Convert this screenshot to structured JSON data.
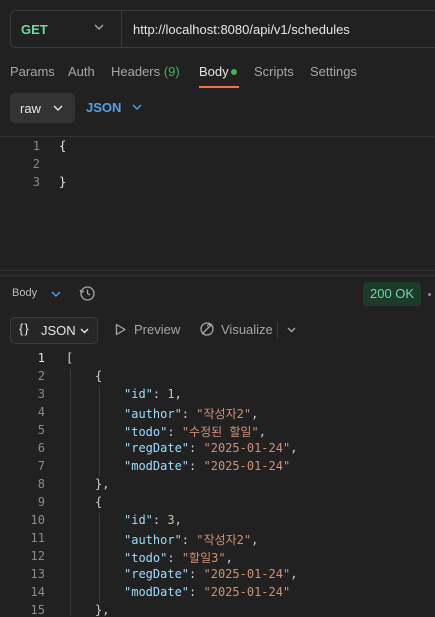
{
  "request": {
    "method": "GET",
    "url": "http://localhost:8080/api/v1/schedules"
  },
  "request_tabs": {
    "params": "Params",
    "auth": "Auth",
    "headers": "Headers",
    "headers_count": "(9)",
    "body": "Body",
    "scripts": "Scripts",
    "settings": "Settings"
  },
  "body_mode": {
    "mode": "raw",
    "language": "JSON"
  },
  "request_body": {
    "line_numbers": [
      "1",
      "2",
      "3"
    ],
    "lines": [
      "{",
      "",
      "}"
    ]
  },
  "response": {
    "section_label": "Body",
    "status": "200 OK",
    "format": "JSON",
    "preview_label": "Preview",
    "visualize_label": "Visualize",
    "line_numbers": [
      "1",
      "2",
      "3",
      "4",
      "5",
      "6",
      "7",
      "8",
      "9",
      "10",
      "11",
      "12",
      "13",
      "14",
      "15"
    ],
    "items": [
      {
        "id": "1",
        "author": "작성자2",
        "todo": "수정된 할일",
        "regDate": "2025-01-24",
        "modDate": "2025-01-24"
      },
      {
        "id": "3",
        "author": "작성자2",
        "todo": "할일3",
        "regDate": "2025-01-24",
        "modDate": "2025-01-24"
      }
    ],
    "keys": {
      "id": "\"id\"",
      "author": "\"author\"",
      "todo": "\"todo\"",
      "regDate": "\"regDate\"",
      "modDate": "\"modDate\""
    }
  },
  "colors": {
    "method_get": "#6bdd9a",
    "accent_orange": "#ff6c37",
    "json_key": "#9cdcfe",
    "json_string": "#ce9178",
    "status_ok": "#6bdd9a"
  },
  "icons": {
    "method_dropdown": "chevron-down-icon",
    "history": "history-icon",
    "preview": "play-icon",
    "visualize": "visualize-icon"
  }
}
